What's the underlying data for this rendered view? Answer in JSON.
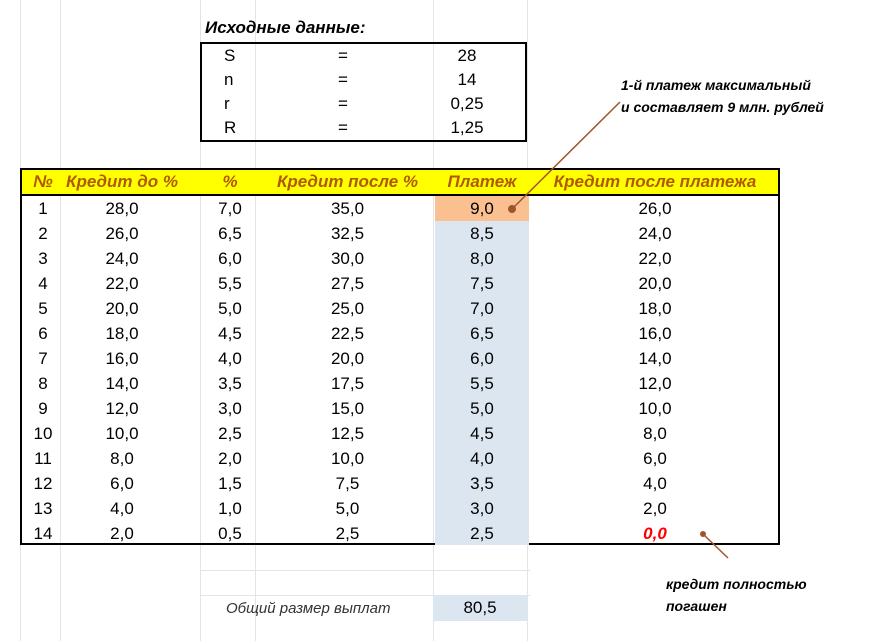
{
  "input": {
    "title": "Исходные данные:",
    "rows": [
      {
        "name": "S",
        "eq": "=",
        "value": "28"
      },
      {
        "name": "n",
        "eq": "=",
        "value": "14"
      },
      {
        "name": "r",
        "eq": "=",
        "value": "0,25"
      },
      {
        "name": "R",
        "eq": "=",
        "value": "1,25"
      }
    ]
  },
  "table": {
    "headers": [
      "№",
      "Кредит до %",
      "%",
      "Кредит после %",
      "Платеж",
      "Кредит после платежа"
    ],
    "rows": [
      [
        "1",
        "28,0",
        "7,0",
        "35,0",
        "9,0",
        "26,0"
      ],
      [
        "2",
        "26,0",
        "6,5",
        "32,5",
        "8,5",
        "24,0"
      ],
      [
        "3",
        "24,0",
        "6,0",
        "30,0",
        "8,0",
        "22,0"
      ],
      [
        "4",
        "22,0",
        "5,5",
        "27,5",
        "7,5",
        "20,0"
      ],
      [
        "5",
        "20,0",
        "5,0",
        "25,0",
        "7,0",
        "18,0"
      ],
      [
        "6",
        "18,0",
        "4,5",
        "22,5",
        "6,5",
        "16,0"
      ],
      [
        "7",
        "16,0",
        "4,0",
        "20,0",
        "6,0",
        "14,0"
      ],
      [
        "8",
        "14,0",
        "3,5",
        "17,5",
        "5,5",
        "12,0"
      ],
      [
        "9",
        "12,0",
        "3,0",
        "15,0",
        "5,0",
        "10,0"
      ],
      [
        "10",
        "10,0",
        "2,5",
        "12,5",
        "4,5",
        "8,0"
      ],
      [
        "11",
        "8,0",
        "2,0",
        "10,0",
        "4,0",
        "6,0"
      ],
      [
        "12",
        "6,0",
        "1,5",
        "7,5",
        "3,5",
        "4,0"
      ],
      [
        "13",
        "4,0",
        "1,0",
        "5,0",
        "3,0",
        "2,0"
      ],
      [
        "14",
        "2,0",
        "0,5",
        "2,5",
        "2,5",
        "0,0"
      ]
    ]
  },
  "total": {
    "label": "Общий размер выплат",
    "value": "80,5"
  },
  "annotations": {
    "max_payment": [
      "1-й платеж максимальный",
      "и составляет 9 млн. рублей"
    ],
    "paid_off": [
      "кредит полностью",
      "погашен"
    ]
  },
  "colors": {
    "header_bg": "#ffff00",
    "header_text": "#b05a00",
    "payment_col": "#dce6f1",
    "first_payment": "#fac090",
    "zero_value": "#ff0000",
    "arrow": "#a0522d"
  }
}
